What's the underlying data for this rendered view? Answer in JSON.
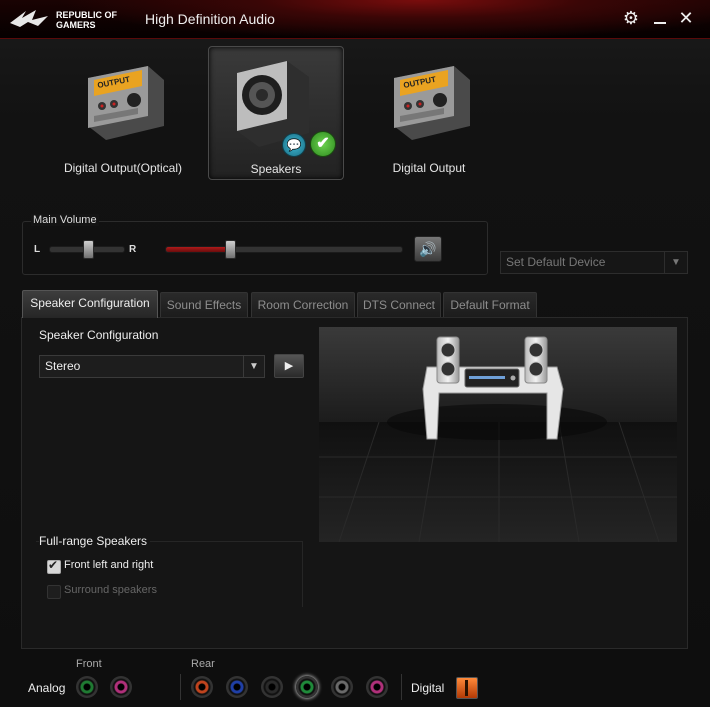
{
  "window": {
    "brand": "REPUBLIC OF GAMERS",
    "title": "High Definition Audio"
  },
  "devices": [
    {
      "label": "Digital Output(Optical)",
      "selected": false
    },
    {
      "label": "Speakers",
      "selected": true
    },
    {
      "label": "Digital Output",
      "selected": false
    }
  ],
  "volume": {
    "label": "Main Volume",
    "left_label": "L",
    "right_label": "R",
    "balance": 0.5,
    "level": 0.27
  },
  "default_device": {
    "label": "Set Default Device"
  },
  "tabs": [
    {
      "label": "Speaker Configuration",
      "active": true
    },
    {
      "label": "Sound Effects",
      "active": false
    },
    {
      "label": "Room Correction",
      "active": false
    },
    {
      "label": "DTS Connect",
      "active": false
    },
    {
      "label": "Default Format",
      "active": false
    }
  ],
  "speaker_config": {
    "label": "Speaker Configuration",
    "selected": "Stereo"
  },
  "full_range": {
    "label": "Full-range Speakers",
    "options": [
      {
        "label": "Front left and right",
        "checked": true,
        "enabled": true
      },
      {
        "label": "Surround speakers",
        "checked": false,
        "enabled": false
      }
    ]
  },
  "jacks": {
    "front_label": "Front",
    "rear_label": "Rear",
    "analog_label": "Analog",
    "digital_label": "Digital",
    "front_colors": [
      "#1f7a32",
      "#b0307a"
    ],
    "rear_colors": [
      "#c0441e",
      "#1f3fa6",
      "#2a2a2a",
      "#1f8a3a",
      "#6a6a6a",
      "#b0307a"
    ]
  },
  "colors": {
    "accent": "#b01010",
    "volume_fill": "#8a1414"
  }
}
